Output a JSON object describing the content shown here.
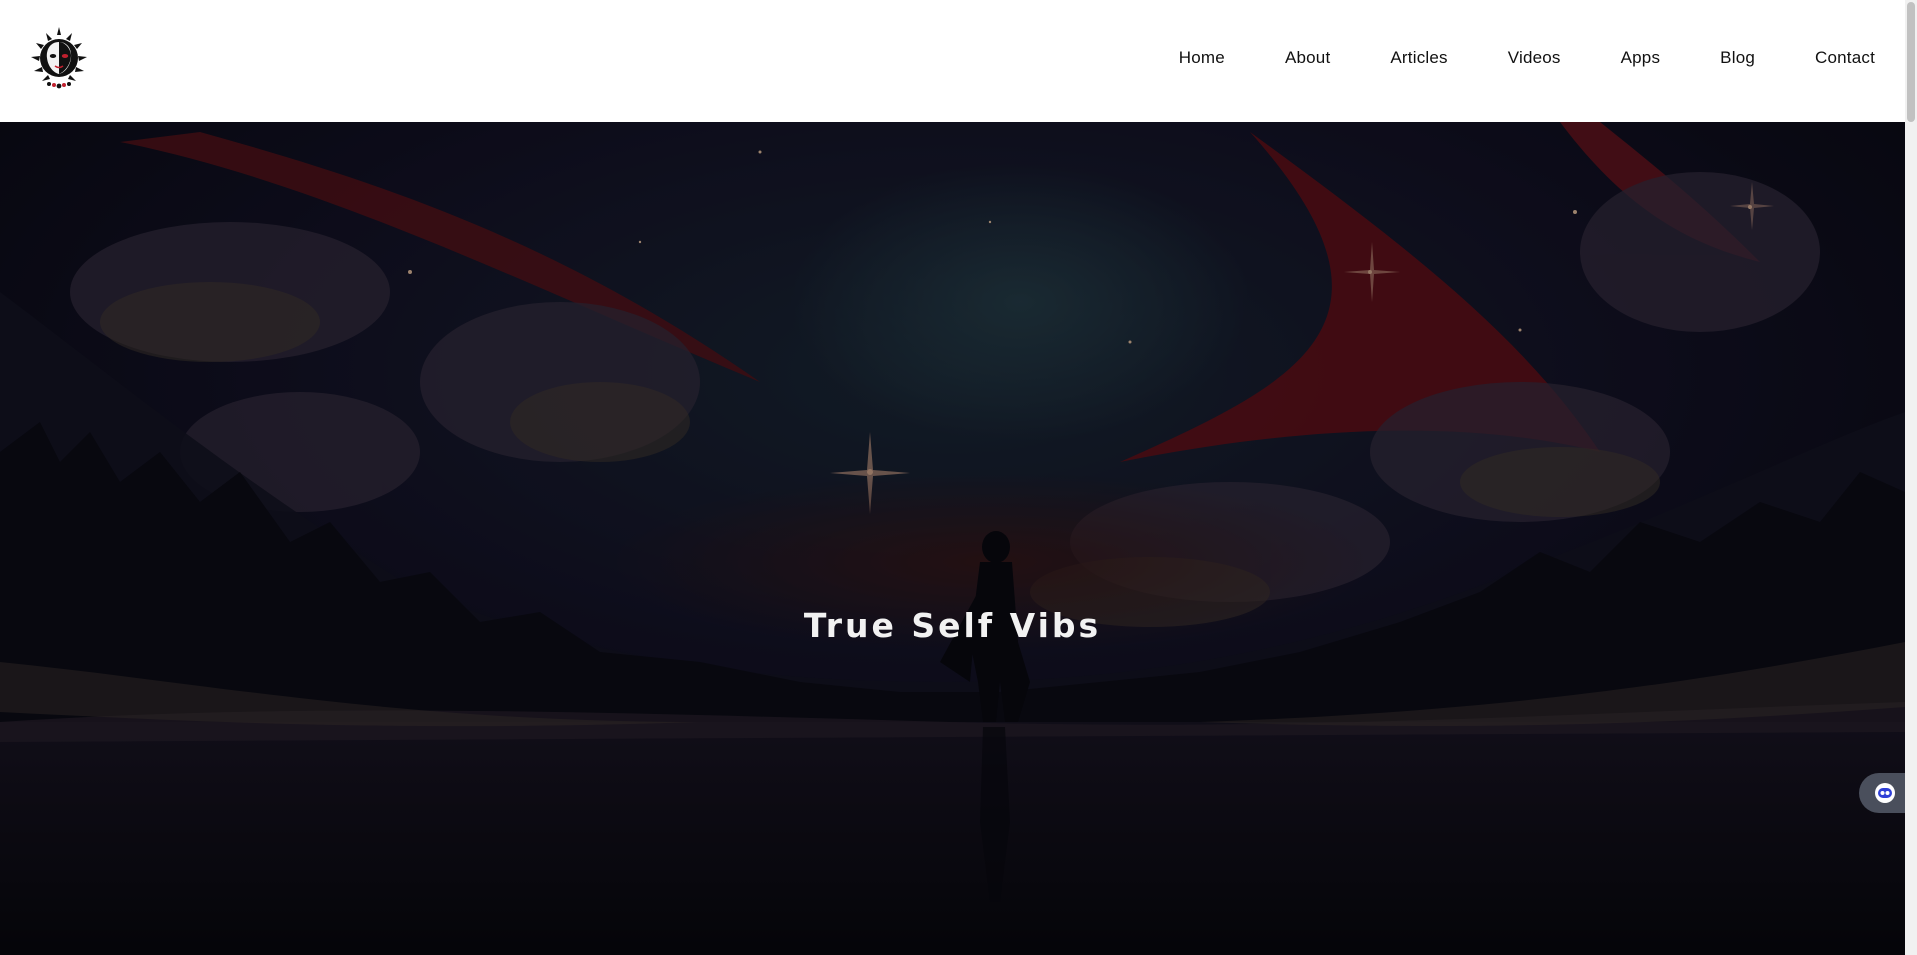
{
  "header": {
    "logo_name": "crest-logo",
    "nav": [
      {
        "label": "Home"
      },
      {
        "label": "About"
      },
      {
        "label": "Articles"
      },
      {
        "label": "Videos"
      },
      {
        "label": "Apps"
      },
      {
        "label": "Blog"
      },
      {
        "label": "Contact"
      }
    ]
  },
  "hero": {
    "title": "True Self Vibs"
  },
  "widget": {
    "icon": "chatbot-icon"
  },
  "colors": {
    "header_bg": "#ffffff",
    "nav_text": "#111111",
    "hero_dark": "#0d0d1a",
    "hero_title": "#f2f2f2",
    "accent_red": "#8b1a24",
    "widget_bg": "#4a4f5c"
  }
}
